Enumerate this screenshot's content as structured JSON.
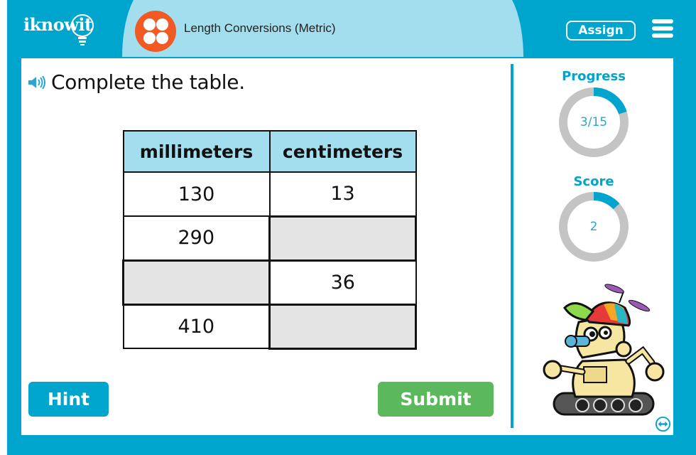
{
  "header": {
    "logo_text": "iknowit",
    "lesson_icon": "four-dots-icon",
    "lesson_title": "Length Conversions (Metric)",
    "assign_label": "Assign",
    "menu_icon": "hamburger-menu-icon"
  },
  "question": {
    "audio_icon": "speaker-icon",
    "prompt": "Complete the table."
  },
  "table": {
    "headers": [
      "millimeters",
      "centimeters"
    ],
    "rows": [
      {
        "mm": "130",
        "cm": "13"
      },
      {
        "mm": "290",
        "cm": ""
      },
      {
        "mm": "",
        "cm": "36"
      },
      {
        "mm": "410",
        "cm": ""
      }
    ],
    "blank_color": "#e4e4e4",
    "header_color": "#a2deed"
  },
  "buttons": {
    "hint_label": "Hint",
    "submit_label": "Submit"
  },
  "sidebar": {
    "progress": {
      "label": "Progress",
      "value_text": "3/15",
      "current": 3,
      "total": 15
    },
    "score": {
      "label": "Score",
      "value_text": "2",
      "fraction": 0.133
    },
    "mascot": "robot-mascot",
    "expand_icon": "expand-arrows-icon"
  },
  "colors": {
    "brand_blue": "#00a5cd",
    "light_blue": "#a2deed",
    "accent_orange": "#f15a24",
    "submit_green": "#5cb85c",
    "ring_gray": "#c4c4c4"
  }
}
